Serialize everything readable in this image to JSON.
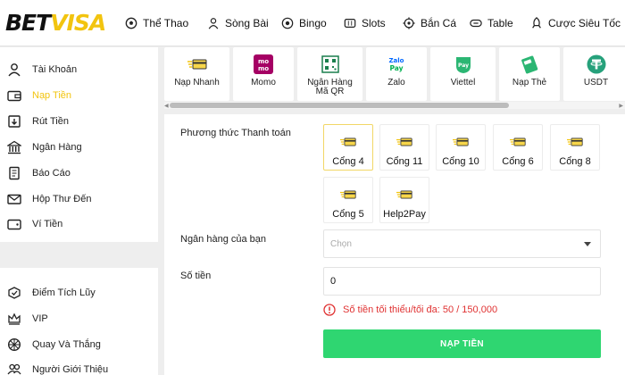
{
  "brand": {
    "part1": "BET",
    "part2": "VISA",
    "accent": "#f2c40f"
  },
  "topnav": [
    {
      "label": "Thể Thao",
      "icon": "soccer-ball-icon"
    },
    {
      "label": "Sòng Bài",
      "icon": "dealer-icon"
    },
    {
      "label": "Bingo",
      "icon": "bingo-ball-icon"
    },
    {
      "label": "Slots",
      "icon": "slot-machine-icon"
    },
    {
      "label": "Bắn Cá",
      "icon": "target-icon"
    },
    {
      "label": "Table",
      "icon": "table-game-icon"
    },
    {
      "label": "Cược Siêu Tốc",
      "icon": "rocket-icon"
    }
  ],
  "sidebar": {
    "account_items": [
      {
        "label": "Tài Khoản",
        "icon": "user-icon",
        "active": false
      },
      {
        "label": "Nạp Tiền",
        "icon": "wallet-deposit-icon",
        "active": true
      },
      {
        "label": "Rút Tiền",
        "icon": "withdraw-icon",
        "active": false
      },
      {
        "label": "Ngân Hàng",
        "icon": "bank-icon",
        "active": false
      },
      {
        "label": "Báo Cáo",
        "icon": "report-icon",
        "active": false
      },
      {
        "label": "Hộp Thư Đến",
        "icon": "mail-icon",
        "active": false
      },
      {
        "label": "Ví Tiền",
        "icon": "wallet-icon",
        "active": false
      }
    ],
    "reward_items": [
      {
        "label": "Điểm Tích Lũy",
        "icon": "points-icon"
      },
      {
        "label": "VIP",
        "icon": "crown-icon"
      },
      {
        "label": "Quay Và Thắng",
        "icon": "wheel-icon"
      },
      {
        "label": "Người Giới Thiệu",
        "icon": "referral-icon"
      }
    ]
  },
  "methods": [
    {
      "label": "Nạp Nhanh",
      "icon": "fast-card-icon"
    },
    {
      "label": "Momo",
      "icon": "momo-icon"
    },
    {
      "label": "Ngân Hàng\nMã QR",
      "icon": "qr-code-icon"
    },
    {
      "label": "Zalo",
      "icon": "zalopay-icon"
    },
    {
      "label": "Viettel",
      "icon": "viettel-pay-icon"
    },
    {
      "label": "Nạp Thẻ",
      "icon": "phone-card-icon"
    },
    {
      "label": "USDT",
      "icon": "tether-icon"
    }
  ],
  "form": {
    "method_label": "Phương thức Thanh toán",
    "gates": [
      {
        "label": "Cổng 4",
        "selected": true
      },
      {
        "label": "Cổng 11",
        "selected": false
      },
      {
        "label": "Cổng 10",
        "selected": false
      },
      {
        "label": "Cổng 6",
        "selected": false
      },
      {
        "label": "Cổng 8",
        "selected": false
      },
      {
        "label": "Cổng 5",
        "selected": false
      },
      {
        "label": "Help2Pay",
        "selected": false
      }
    ],
    "bank_label": "Ngân hàng của bạn",
    "bank_placeholder": "Chọn",
    "amount_label": "Số tiền",
    "amount_value": "0",
    "limit_warning": "Số tiền tối thiểu/tối đa: 50 / 150,000",
    "submit_label": "NẠP TIỀN"
  },
  "colors": {
    "accent": "#f2c40f",
    "submit": "#2fd671",
    "error": "#e03232"
  }
}
